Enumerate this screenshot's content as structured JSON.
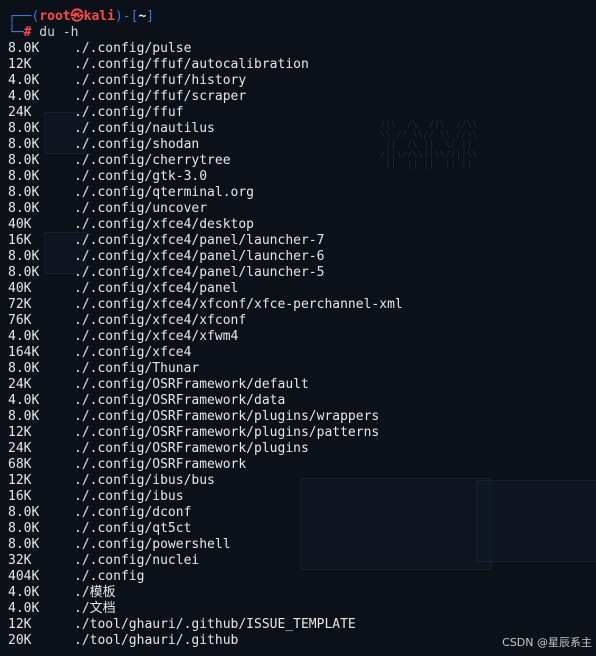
{
  "prompt": {
    "open_bracket": "┌──(",
    "user": "root",
    "at_symbol": "㉿",
    "host": "kali",
    "mid": ")-[",
    "cwd": "~",
    "close_bracket": "]",
    "line2_prefix": "└─",
    "hash": "#",
    "command": " du -h"
  },
  "rows": [
    {
      "size": "8.0K",
      "path": "./.config/pulse"
    },
    {
      "size": "12K",
      "path": "./.config/ffuf/autocalibration"
    },
    {
      "size": "4.0K",
      "path": "./.config/ffuf/history"
    },
    {
      "size": "4.0K",
      "path": "./.config/ffuf/scraper"
    },
    {
      "size": "24K",
      "path": "./.config/ffuf"
    },
    {
      "size": "8.0K",
      "path": "./.config/nautilus"
    },
    {
      "size": "8.0K",
      "path": "./.config/shodan"
    },
    {
      "size": "8.0K",
      "path": "./.config/cherrytree"
    },
    {
      "size": "8.0K",
      "path": "./.config/gtk-3.0"
    },
    {
      "size": "8.0K",
      "path": "./.config/qterminal.org"
    },
    {
      "size": "8.0K",
      "path": "./.config/uncover"
    },
    {
      "size": "40K",
      "path": "./.config/xfce4/desktop"
    },
    {
      "size": "16K",
      "path": "./.config/xfce4/panel/launcher-7"
    },
    {
      "size": "8.0K",
      "path": "./.config/xfce4/panel/launcher-6"
    },
    {
      "size": "8.0K",
      "path": "./.config/xfce4/panel/launcher-5"
    },
    {
      "size": "40K",
      "path": "./.config/xfce4/panel"
    },
    {
      "size": "72K",
      "path": "./.config/xfce4/xfconf/xfce-perchannel-xml"
    },
    {
      "size": "76K",
      "path": "./.config/xfce4/xfconf"
    },
    {
      "size": "4.0K",
      "path": "./.config/xfce4/xfwm4"
    },
    {
      "size": "164K",
      "path": "./.config/xfce4"
    },
    {
      "size": "8.0K",
      "path": "./.config/Thunar"
    },
    {
      "size": "24K",
      "path": "./.config/OSRFramework/default"
    },
    {
      "size": "4.0K",
      "path": "./.config/OSRFramework/data"
    },
    {
      "size": "8.0K",
      "path": "./.config/OSRFramework/plugins/wrappers"
    },
    {
      "size": "12K",
      "path": "./.config/OSRFramework/plugins/patterns"
    },
    {
      "size": "24K",
      "path": "./.config/OSRFramework/plugins"
    },
    {
      "size": "68K",
      "path": "./.config/OSRFramework"
    },
    {
      "size": "12K",
      "path": "./.config/ibus/bus"
    },
    {
      "size": "16K",
      "path": "./.config/ibus"
    },
    {
      "size": "8.0K",
      "path": "./.config/dconf"
    },
    {
      "size": "8.0K",
      "path": "./.config/qt5ct"
    },
    {
      "size": "8.0K",
      "path": "./.config/powershell"
    },
    {
      "size": "32K",
      "path": "./.config/nuclei"
    },
    {
      "size": "404K",
      "path": "./.config"
    },
    {
      "size": "4.0K",
      "path": "./模板"
    },
    {
      "size": "4.0K",
      "path": "./文档"
    },
    {
      "size": "12K",
      "path": "./tool/ghauri/.github/ISSUE_TEMPLATE"
    },
    {
      "size": "20K",
      "path": "./tool/ghauri/.github"
    }
  ],
  "watermark": "CSDN @星辰系主",
  "colors": {
    "background": "#0c1119",
    "prompt_blue": "#3a7bd5",
    "prompt_red": "#ff4a4a",
    "text": "#e6e6e6"
  }
}
